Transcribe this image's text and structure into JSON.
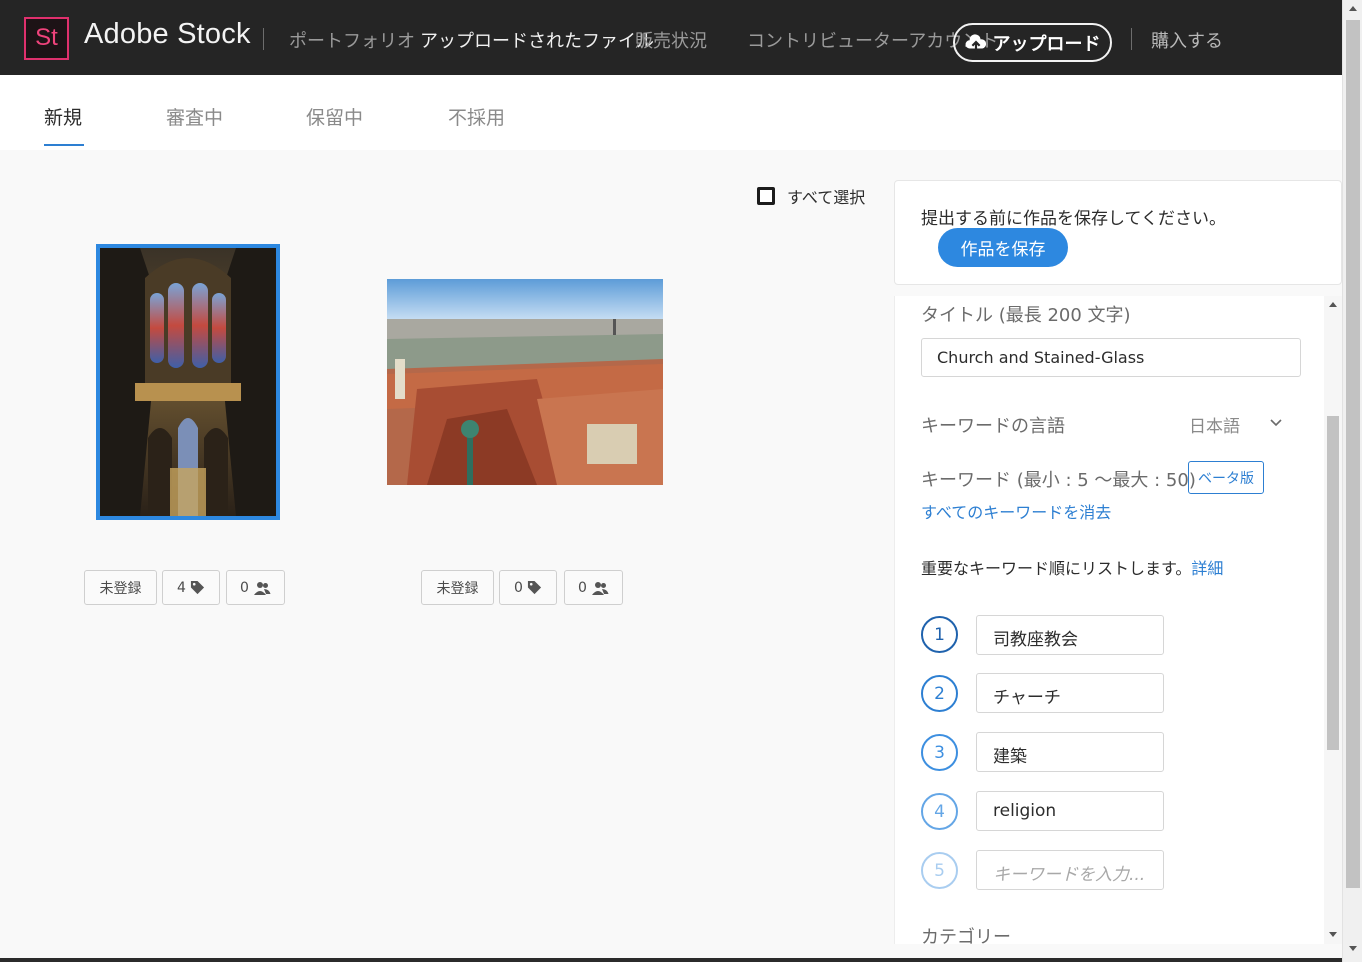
{
  "header": {
    "logo_text": "St",
    "brand": "Adobe Stock",
    "nav": [
      {
        "label": "ポートフォリオ",
        "active": false
      },
      {
        "label": "アップロードされたファイル",
        "active": true
      },
      {
        "label": "販売状況",
        "active": false
      },
      {
        "label": "コントリビューターアカウント",
        "active": false
      }
    ],
    "upload_label": "アップロード",
    "buy_label": "購入する"
  },
  "tabs": [
    {
      "label": "新規",
      "active": true
    },
    {
      "label": "審査中",
      "active": false
    },
    {
      "label": "保留中",
      "active": false
    },
    {
      "label": "不採用",
      "active": false
    }
  ],
  "select_all_label": "すべて選択",
  "items": [
    {
      "image": "cathedral-interior",
      "status": "未登録",
      "keyword_count": "4",
      "release_count": "0",
      "selected": true
    },
    {
      "image": "city-rooftops",
      "status": "未登録",
      "keyword_count": "0",
      "release_count": "0",
      "selected": false
    }
  ],
  "save_panel": {
    "message": "提出する前に作品を保存してください。",
    "button": "作品を保存"
  },
  "details": {
    "title_label": "タイトル (最長 200 文字)",
    "title_value": "Church and Stained-Glass",
    "keyword_language_label": "キーワードの言語",
    "keyword_language_value": "日本語",
    "keywords_label": "キーワード (最小 : 5 〜最大 : 50)",
    "beta_label": "ベータ版",
    "clear_keywords_link": "すべてのキーワードを消去",
    "hint_text": "重要なキーワード順にリストします。",
    "hint_link": "詳細",
    "keywords": [
      {
        "num": "1",
        "value": "司教座教会"
      },
      {
        "num": "2",
        "value": "チャーチ"
      },
      {
        "num": "3",
        "value": "建築"
      },
      {
        "num": "4",
        "value": "religion"
      },
      {
        "num": "5",
        "value": ""
      }
    ],
    "keyword_placeholder": "キーワードを入力...",
    "category_label": "カテゴリー"
  },
  "colors": {
    "accent": "#2d88e0",
    "topbar": "#252525",
    "logo": "#e0306d"
  }
}
